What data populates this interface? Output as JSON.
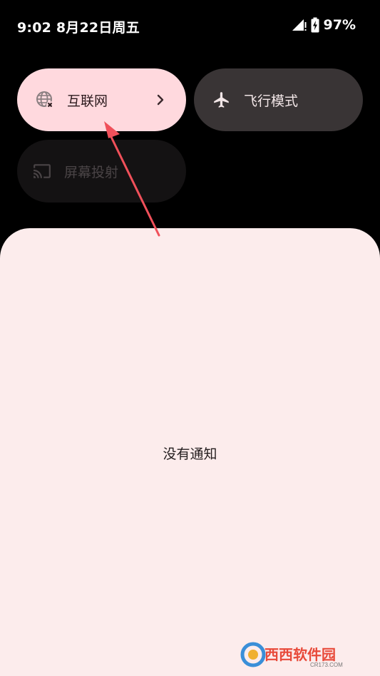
{
  "status_bar": {
    "time_date": "9:02 8月22日周五",
    "battery_percent": "97%",
    "signal_icon": "signal-no-service-icon",
    "battery_icon": "battery-charging-icon"
  },
  "quick_settings": {
    "tiles": [
      {
        "label": "互联网",
        "icon": "globe-off-icon",
        "state": "active",
        "has_chevron": true
      },
      {
        "label": "飞行模式",
        "icon": "airplane-icon",
        "state": "inactive"
      },
      {
        "label": "屏幕投射",
        "icon": "cast-icon",
        "state": "unavailable"
      }
    ]
  },
  "notifications": {
    "empty_text": "没有通知"
  },
  "watermark": {
    "logo_text": "西西软件园",
    "logo_subtext": "CR173.COM"
  },
  "colors": {
    "background": "#000000",
    "internet_tile": "#ffd9de",
    "airplane_tile": "#393435",
    "cast_tile": "#141213",
    "panel": "#fcecec",
    "annotation_arrow": "#f0505a"
  }
}
